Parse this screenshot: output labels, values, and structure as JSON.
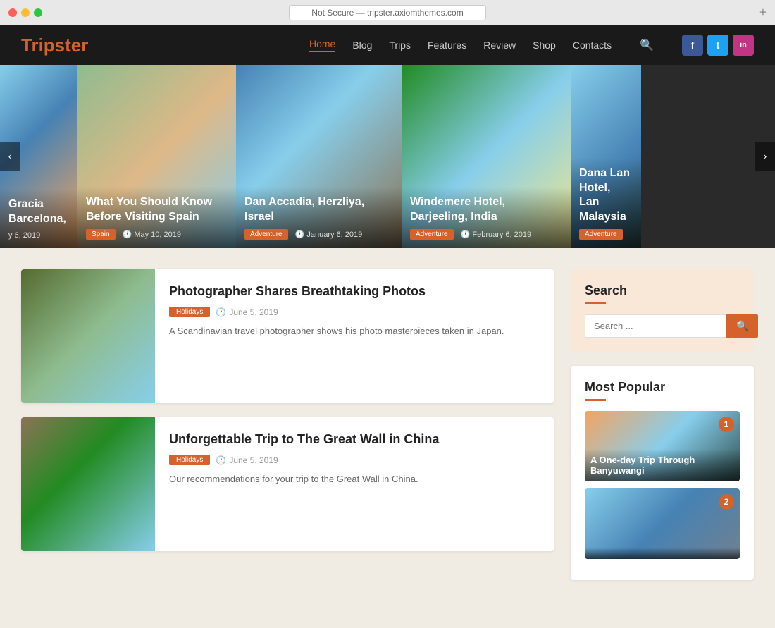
{
  "browser": {
    "url": "Not Secure — tripster.axiomthemes.com",
    "plus": "+"
  },
  "header": {
    "logo_prefix": "Trip",
    "logo_suffix": "ster",
    "nav_items": [
      {
        "label": "Home",
        "active": true
      },
      {
        "label": "Blog",
        "active": false
      },
      {
        "label": "Trips",
        "active": false
      },
      {
        "label": "Features",
        "active": false
      },
      {
        "label": "Review",
        "active": false
      },
      {
        "label": "Shop",
        "active": false
      },
      {
        "label": "Contacts",
        "active": false
      }
    ],
    "social": [
      {
        "label": "f",
        "type": "fb"
      },
      {
        "label": "t",
        "type": "tw"
      },
      {
        "label": "in",
        "type": "ig"
      }
    ]
  },
  "slider": {
    "prev_label": "‹",
    "next_label": "›",
    "slides": [
      {
        "title": "Gracia Barcelona,",
        "tag": "",
        "date": "y 6, 2019",
        "bg": "slide-bg-1",
        "partial": true
      },
      {
        "title": "What You Should Know Before Visiting Spain",
        "tag": "Spain",
        "date": "May 10, 2019",
        "bg": "slide-bg-2"
      },
      {
        "title": "Dan Accadia, Herzliya, Israel",
        "tag": "Adventure",
        "date": "January 6, 2019",
        "bg": "slide-bg-3"
      },
      {
        "title": "Windemere Hotel, Darjeeling, India",
        "tag": "Adventure",
        "date": "February 6, 2019",
        "bg": "slide-bg-4"
      },
      {
        "title": "Dana Lan Hotel, Lan Malaysia",
        "tag": "Adventure",
        "date": "",
        "bg": "slide-bg-5",
        "partial": true
      }
    ]
  },
  "posts": [
    {
      "title": "Photographer Shares Breathtaking Photos",
      "tag": "Holidays",
      "date": "June 5, 2019",
      "excerpt": "A Scandinavian travel photographer shows his photo masterpieces taken in Japan.",
      "bg": "post-thumb-1"
    },
    {
      "title": "Unforgettable Trip to The Great Wall in China",
      "tag": "Holidays",
      "date": "June 5, 2019",
      "excerpt": "Our recommendations for your trip to the Great Wall in China.",
      "bg": "post-thumb-2"
    }
  ],
  "sidebar": {
    "search_widget_title": "Search",
    "search_placeholder": "Search ...",
    "popular_title": "Most Popular",
    "popular_items": [
      {
        "title": "A One-day Trip Through Banyuwangi",
        "rank": "1",
        "bg": "popular-thumb-1"
      },
      {
        "title": "",
        "rank": "2",
        "bg": "popular-thumb-2"
      }
    ]
  },
  "icons": {
    "clock": "🕐",
    "search": "🔍"
  }
}
